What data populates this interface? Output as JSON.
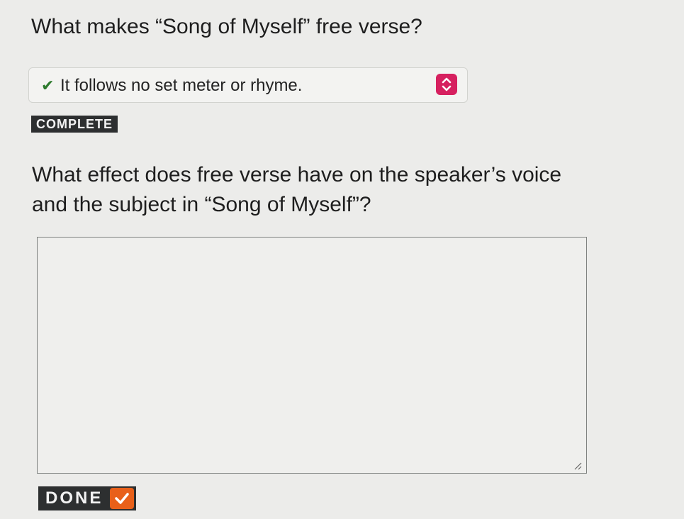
{
  "question1": {
    "prompt": "What makes “Song of Myself” free verse?",
    "selected_answer": "It follows no set meter or rhyme.",
    "check_glyph": "✔",
    "status_badge": "COMPLETE"
  },
  "question2": {
    "prompt": "What effect does free verse have on the speaker’s voice and the subject in “Song of Myself”?",
    "response_value": ""
  },
  "done_button": {
    "label": "DONE"
  },
  "icons": {
    "answer_check": "check-icon",
    "select_toggle": "chevron-up-down-icon",
    "resize_handle": "resize-grip-icon",
    "done_check": "checkmark-icon"
  },
  "colors": {
    "toggle_accent": "#d6205f",
    "done_check_accent": "#e8601a",
    "correct_check": "#2d7a2d",
    "badge_bg": "#2d2f30"
  }
}
